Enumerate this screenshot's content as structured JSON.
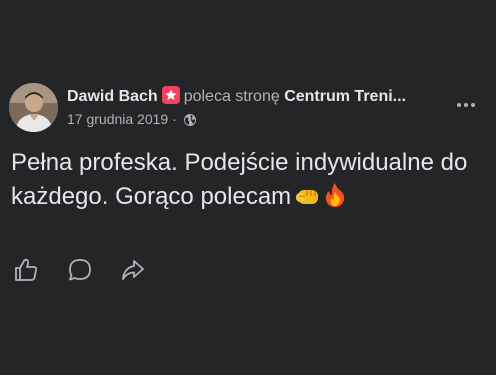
{
  "post": {
    "author": "Dawid Bach",
    "action_text": "poleca stronę",
    "page_name": "Centrum Treni",
    "truncation": "...",
    "date": "17 grudnia 2019",
    "separator": "·",
    "privacy_icon": "globe-icon",
    "recommend_icon": "recommend-badge-icon",
    "menu_icon": "more-options-icon",
    "body": "Pełna profeska. Podejście indywidualne do każdego. Gorąco polecam",
    "emojis": [
      "oncoming-fist-emoji",
      "fire-emoji"
    ]
  },
  "actions": {
    "like_icon": "like-icon",
    "comment_icon": "comment-icon",
    "share_icon": "share-icon"
  },
  "colors": {
    "background": "#242526",
    "primary_text": "#e4e6eb",
    "secondary_text": "#b0b3b8",
    "recommend_badge": "#f3425f"
  }
}
